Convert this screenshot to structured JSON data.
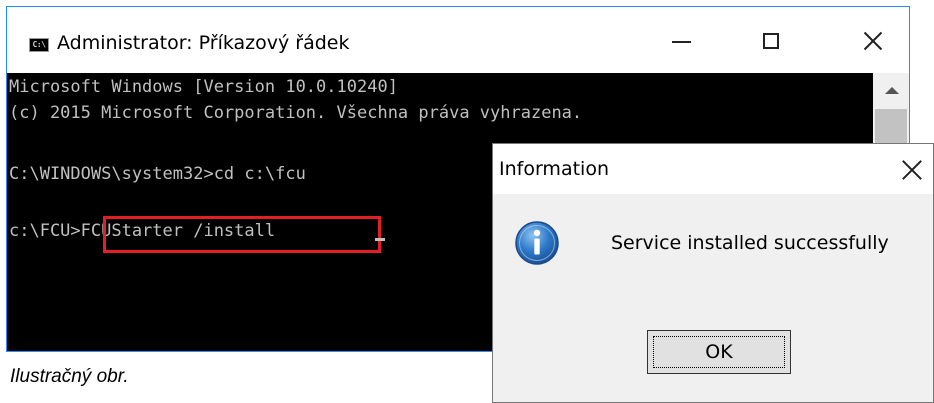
{
  "cmd_window": {
    "icon_text": "C:\\",
    "title": "Administrator: Příkazový řádek",
    "console_lines": [
      "Microsoft Windows [Version 10.0.10240]",
      "(c) 2015 Microsoft Corporation. Všechna práva vyhrazena.",
      "",
      "C:\\WINDOWS\\system32>cd c:\\fcu",
      "",
      "c:\\FCU>FCUStarter /install"
    ],
    "highlight_color": "#e31e24"
  },
  "info_dialog": {
    "title": "Information",
    "message": "Service installed successfully",
    "ok_label": "OK",
    "icon": "info-icon"
  },
  "caption": "Ilustračný obr.",
  "colors": {
    "console_bg": "#000000",
    "console_text": "#c0c0c0",
    "window_border": "#1e90ff",
    "dialog_bg": "#f0f0f0",
    "info_icon_blue": "#1f5fae"
  }
}
